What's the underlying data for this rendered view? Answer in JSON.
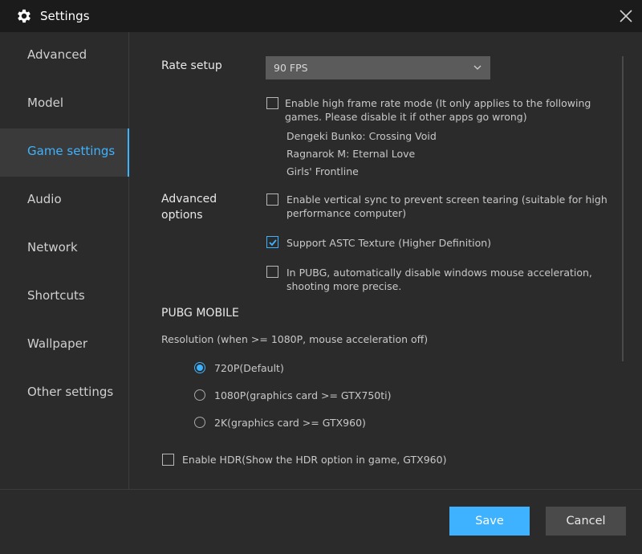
{
  "window": {
    "title": "Settings",
    "icon": "gear-icon"
  },
  "sidebar": {
    "items": [
      {
        "label": "Advanced",
        "active": false
      },
      {
        "label": "Model",
        "active": false
      },
      {
        "label": "Game settings",
        "active": true
      },
      {
        "label": "Audio",
        "active": false
      },
      {
        "label": "Network",
        "active": false
      },
      {
        "label": "Shortcuts",
        "active": false
      },
      {
        "label": "Wallpaper",
        "active": false
      },
      {
        "label": "Other settings",
        "active": false
      }
    ]
  },
  "main": {
    "rate_setup": {
      "label": "Rate setup",
      "selected": "90 FPS",
      "high_frame_rate": {
        "checked": false,
        "line1": "Enable high frame rate mode  (It only applies to the following",
        "line2": "games. Please disable it if other apps go wrong)",
        "games": [
          "Dengeki Bunko: Crossing Void",
          "Ragnarok M: Eternal Love",
          "Girls' Frontline"
        ]
      }
    },
    "advanced_options": {
      "label_line1": "Advanced",
      "label_line2": "options",
      "vsync": {
        "checked": false,
        "line1": "Enable vertical sync to prevent screen tearing  (suitable for high",
        "line2": "performance computer)"
      },
      "astc": {
        "checked": true,
        "label": "Support ASTC Texture    (Higher Definition)"
      },
      "pubg_mouse": {
        "checked": false,
        "line1": "In PUBG, automatically disable windows mouse acceleration,",
        "line2": "shooting more precise."
      }
    },
    "pubg": {
      "title": "PUBG MOBILE",
      "resolution_label": "Resolution (when >= 1080P, mouse acceleration off)",
      "options": [
        {
          "label": "720P(Default)",
          "selected": true
        },
        {
          "label": "1080P(graphics card >= GTX750ti)",
          "selected": false
        },
        {
          "label": "2K(graphics card >= GTX960)",
          "selected": false
        }
      ],
      "hdr": {
        "checked": false,
        "label": "Enable HDR(Show the HDR option in game, GTX960)"
      }
    }
  },
  "footer": {
    "save_label": "Save",
    "cancel_label": "Cancel"
  },
  "colors": {
    "accent": "#3fb2ff",
    "titlebar": "#1b1b1b",
    "background": "#2b2b2b",
    "select": "#5b5b5b"
  }
}
